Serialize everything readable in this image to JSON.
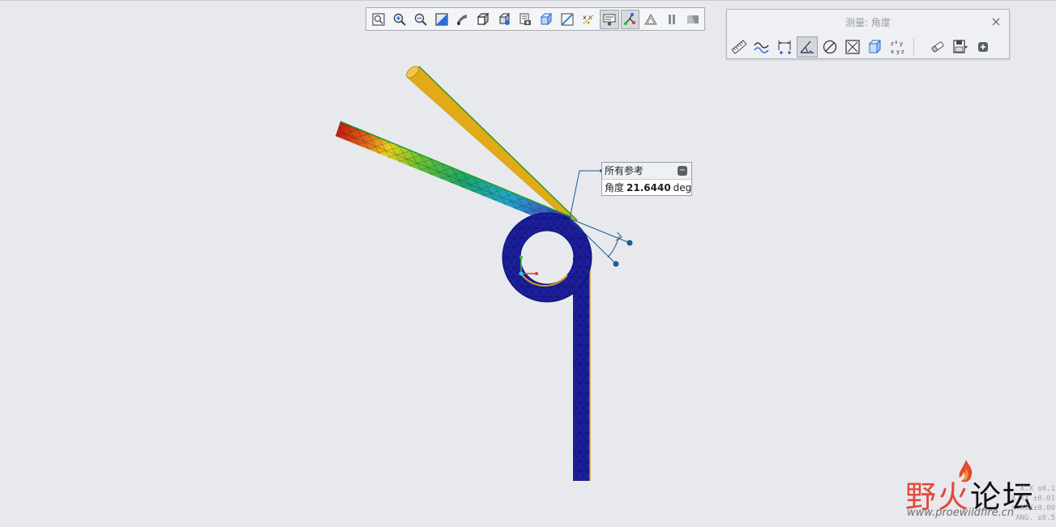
{
  "graphics_toolbar": {
    "icons": [
      "refit-icon",
      "zoom-in-icon",
      "zoom-out-icon",
      "repaint-icon",
      "perspective-icon",
      "display-style-icon",
      "saved-orientations-icon",
      "view-manager-icon",
      "datum-display-icon",
      "annotation-display-icon",
      "spin-center-icon",
      "annotation-filter-icon",
      "flow-display-icon",
      "measure-icon",
      "pause-icon",
      "navigate-icon"
    ],
    "active": [
      "annotation-filter-icon",
      "flow-display-icon"
    ]
  },
  "measure_panel": {
    "title": "测量: 角度",
    "close_glyph": "×",
    "tools": [
      "length-icon",
      "curve-length-icon",
      "distance-icon",
      "angle-icon",
      "diameter-icon",
      "area-icon",
      "volume-icon",
      "transform-icon"
    ],
    "active_tool": "angle-icon",
    "right_tools": [
      "eraser-icon",
      "save-icon",
      "add-icon"
    ]
  },
  "callout": {
    "header": "所有参考",
    "label": "角度",
    "value": "21.6440",
    "unit": "deg"
  },
  "watermark": {
    "logo_part1": "野",
    "logo_part2": "火",
    "logo_part3": "论坛",
    "url": "www.proewildfire.cn"
  },
  "tolerance_text": [
    "X.X  ±0.1",
    "X.XX ±0.01",
    "X.XXX±0.00",
    "ANG. ±0.5"
  ],
  "colors": {
    "background": "#e8e9ed",
    "yellow_bar": "#e2aa17",
    "spring_blue": "#1c1f9e",
    "accent_line": "#1a5d8f"
  }
}
